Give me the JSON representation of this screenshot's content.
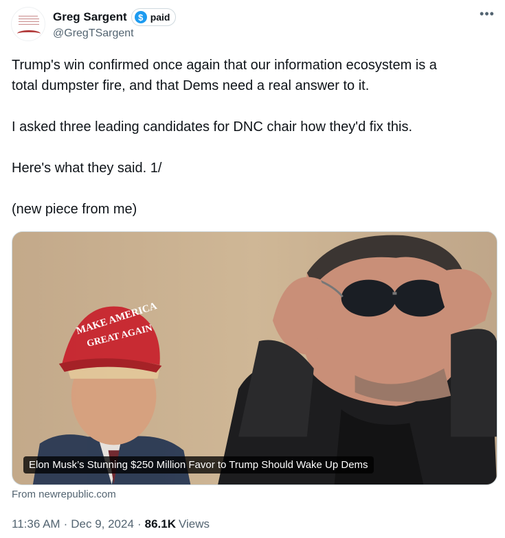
{
  "author": {
    "display_name": "Greg Sargent",
    "badge_label": "paid",
    "badge_icon": "$",
    "handle": "@GregTSargent"
  },
  "tweet": {
    "paragraphs": [
      "Trump's win confirmed once again that our information ecosystem is a",
      "total dumpster fire, and that Dems need a real answer to it.",
      "I asked three leading candidates for DNC chair how they'd fix this.",
      "Here's what they said. 1/",
      "(new piece from me)"
    ]
  },
  "card": {
    "title": "Elon Musk’s Stunning $250 Million Favor to Trump Should Wake Up Dems",
    "source": "From newrepublic.com",
    "hat_text_line1": "MAKE AMERICA",
    "hat_text_line2": "GREAT AGAIN"
  },
  "meta": {
    "time": "11:36 AM",
    "date": "Dec 9, 2024",
    "views_count": "86.1K",
    "views_label": "Views",
    "separator": "·"
  },
  "colors": {
    "accent": "#1d9bf0",
    "text_primary": "#0f1419",
    "text_secondary": "#536471"
  }
}
